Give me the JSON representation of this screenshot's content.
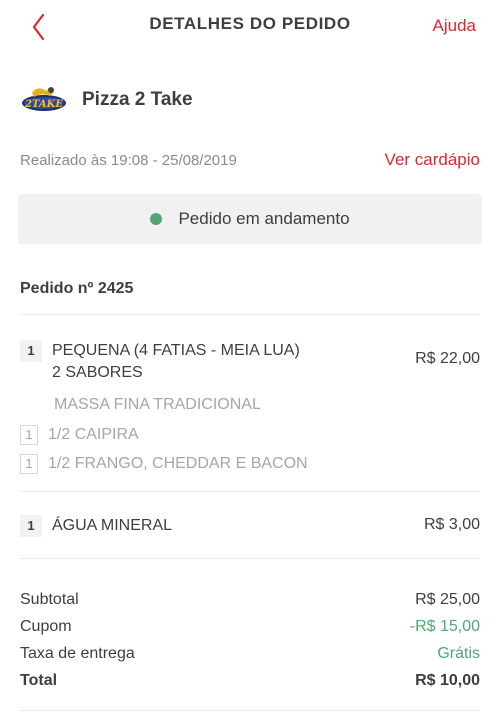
{
  "header": {
    "title": "DETALHES DO PEDIDO",
    "help": "Ajuda"
  },
  "store": {
    "name": "Pizza 2 Take",
    "logo_text": "2TAKE"
  },
  "order_meta": {
    "placed": "Realizado às 19:08 - 25/08/2019",
    "menu_link": "Ver cardápio"
  },
  "status": {
    "text": "Pedido em andamento",
    "color": "#50a773"
  },
  "order": {
    "number_label": "Pedido nº 2425"
  },
  "items": [
    {
      "qty": "1",
      "name_line1": "PEQUENA (4 FATIAS - MEIA LUA)",
      "name_line2": "2 SABORES",
      "price": "R$ 22,00",
      "note": "MASSA FINA TRADICIONAL",
      "options": [
        {
          "qty": "1",
          "name": "1/2 CAIPIRA"
        },
        {
          "qty": "1",
          "name": "1/2 FRANGO, CHEDDAR E BACON"
        }
      ]
    },
    {
      "qty": "1",
      "name_line1": "ÁGUA MINERAL",
      "price": "R$ 3,00"
    }
  ],
  "totals": {
    "subtotal_label": "Subtotal",
    "subtotal_value": "R$ 25,00",
    "coupon_label": "Cupom",
    "coupon_value": "-R$ 15,00",
    "delivery_label": "Taxa de entrega",
    "delivery_value": "Grátis",
    "total_label": "Total",
    "total_value": "R$ 10,00"
  },
  "colors": {
    "accent": "#d8292f",
    "positive": "#50a773",
    "text": "#3f3e3e",
    "muted": "#a6a6a6"
  }
}
